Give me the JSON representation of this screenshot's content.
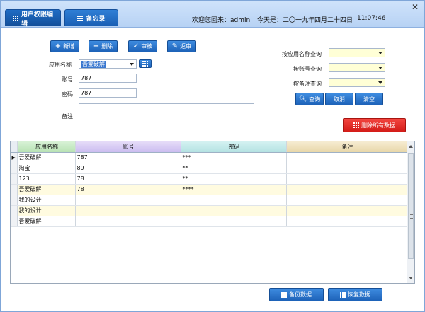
{
  "tabs": [
    {
      "label": "用户权限编辑",
      "active": true
    },
    {
      "label": "备忘录",
      "active": false
    }
  ],
  "status": {
    "welcome": "欢迎您回来：admin",
    "date": "今天是：二〇一九年四月二十四日",
    "time": "11:07:46"
  },
  "toolbar": {
    "add": "新增",
    "delete": "删除",
    "audit": "审核",
    "unaudit": "返审"
  },
  "form": {
    "app_label": "应用名称",
    "app_value": "吾爱破解",
    "account_label": "账号",
    "account_value": "787",
    "password_label": "密码",
    "password_value": "787",
    "note_label": "备注",
    "note_value": ""
  },
  "query": {
    "by_app": "按应用名称查询",
    "by_account": "按账号查询",
    "by_note": "按备注查询",
    "query_btn": "查询",
    "cancel_btn": "取消",
    "clear_btn": "清空",
    "delete_all_btn": "删除所有数据"
  },
  "table": {
    "headers": [
      "应用名称",
      "账号",
      "密码",
      "备注"
    ],
    "rows": [
      [
        "吾爱破解",
        "787",
        "***",
        ""
      ],
      [
        "淘宝",
        "89",
        "**",
        ""
      ],
      [
        "123",
        "78",
        "**",
        ""
      ],
      [
        "吾爱破解",
        "78",
        "****",
        ""
      ],
      [
        "我的设计",
        "",
        "",
        ""
      ],
      [
        "我的设计",
        "",
        "",
        ""
      ],
      [
        "吾爱破解",
        "",
        "",
        ""
      ]
    ],
    "selected_row": 0
  },
  "footer": {
    "backup": "备份数据",
    "restore": "恢复数据"
  },
  "colors": {
    "primary_button": "#1d62b8",
    "danger_button": "#d41c18",
    "title_bar": "#b7d2f4",
    "select_bg": "#ffffd6"
  }
}
